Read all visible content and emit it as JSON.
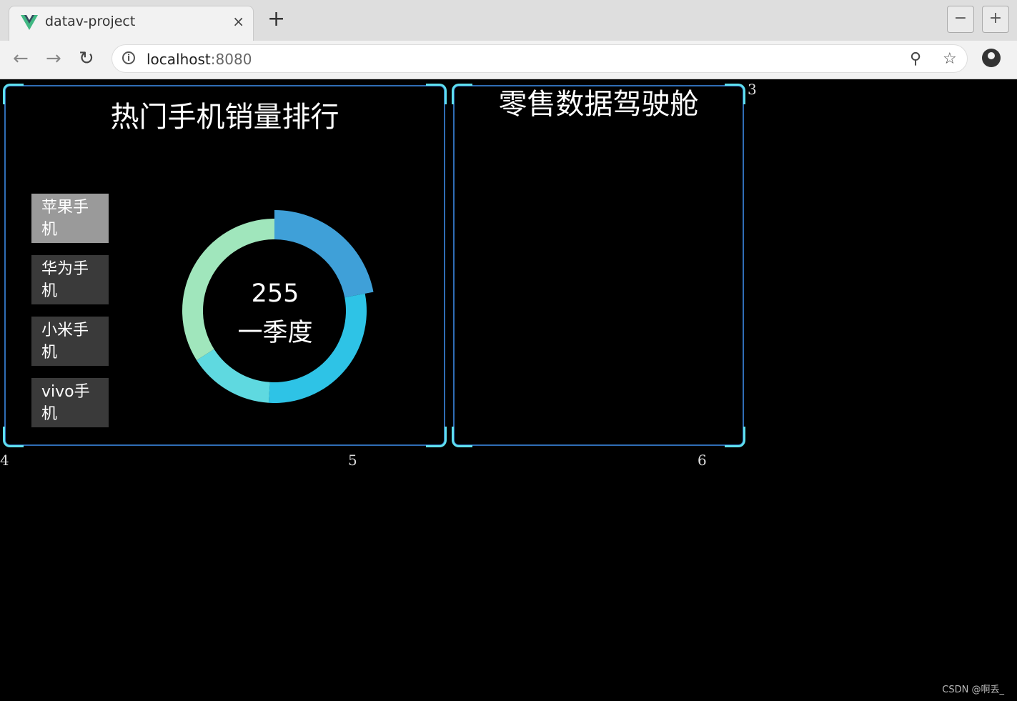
{
  "browser": {
    "tab_title": "datav-project",
    "tab_close": "×",
    "new_tab": "+",
    "minimize": "−",
    "maximize": "+",
    "url_host": "localhost",
    "url_port": ":8080",
    "back_glyph": "←",
    "forward_glyph": "→",
    "reload_glyph": "↻",
    "zoom_glyph": "⚲",
    "star_glyph": "☆",
    "info_glyph": "i"
  },
  "left_panel": {
    "title": "热门手机销量排行",
    "buttons": [
      {
        "label": "苹果手\n机",
        "active": true
      },
      {
        "label": "华为手\n机",
        "active": false
      },
      {
        "label": "小米手\n机",
        "active": false
      },
      {
        "label": "vivo手\n机",
        "active": false
      }
    ],
    "center_value": "255",
    "center_label": "一季度"
  },
  "right_panel": {
    "title": "零售数据驾驶舱"
  },
  "chart_data": {
    "type": "pie",
    "slices": [
      {
        "value": 22,
        "color": "#3fa0d8"
      },
      {
        "value": 29,
        "color": "#2ec3e6"
      },
      {
        "value": 15,
        "color": "#5fd9e0"
      },
      {
        "value": 34,
        "color": "#a0e6bc"
      }
    ]
  },
  "labels": {
    "n3": "3",
    "n4": "4",
    "n5": "5",
    "n6": "6",
    "watermark": "CSDN @啊丢_"
  }
}
